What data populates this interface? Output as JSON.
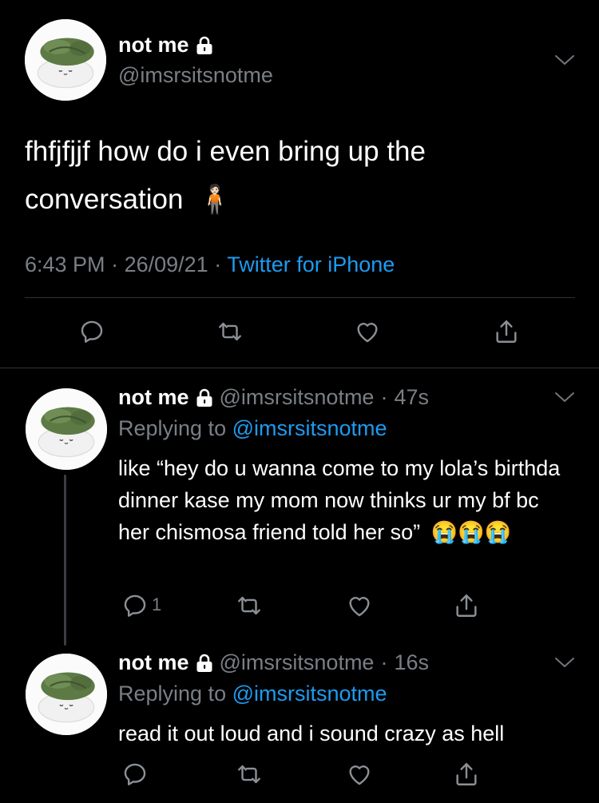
{
  "main": {
    "name": "not me",
    "handle": "@imsrsitsnotme",
    "text": "fhfjfjjf how do i even bring up the conversation",
    "emoji": "🧍🏻",
    "time": "6:43 PM",
    "date": "26/09/21",
    "source": "Twitter for iPhone",
    "dot": "·"
  },
  "replies": [
    {
      "name": "not me",
      "handle": "@imsrsitsnotme",
      "age": "47s",
      "replying_label": "Replying to",
      "replying_handle": "@imsrsitsnotme",
      "text": "like “hey do u wanna come to my lola’s birthda dinner kase my mom now thinks ur my bf bc her chismosa friend told her so”",
      "emojis": "😭😭😭",
      "reply_count": "1"
    },
    {
      "name": "not me",
      "handle": "@imsrsitsnotme",
      "age": "16s",
      "replying_label": "Replying to",
      "replying_handle": "@imsrsitsnotme",
      "text": "read it out loud and i sound crazy as hell"
    }
  ],
  "dot": "·",
  "icons": [
    "reply-icon",
    "retweet-icon",
    "like-icon",
    "share-icon",
    "lock-icon",
    "chevron-down-icon"
  ],
  "colors": {
    "background": "#000000",
    "link": "#1d9bf0",
    "muted": "#7a7f85",
    "divider": "#2f3336"
  }
}
